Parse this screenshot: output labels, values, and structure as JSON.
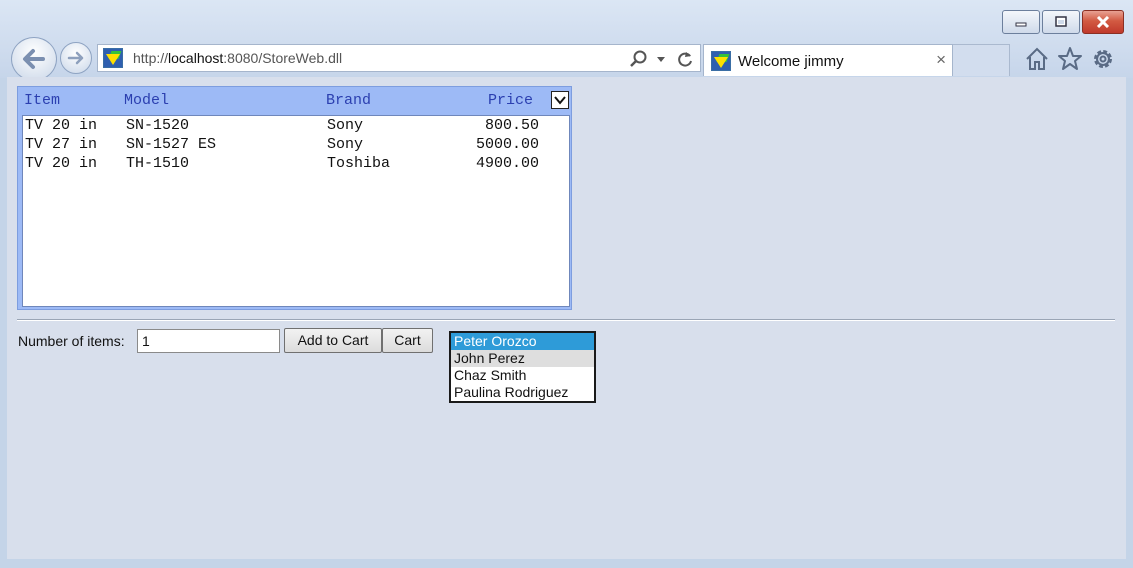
{
  "browser": {
    "url_prefix": "http://",
    "url_host": "localhost",
    "url_rest": ":8080/StoreWeb.dll",
    "tab_title": "Welcome jimmy",
    "tab_close": "×"
  },
  "grid": {
    "headers": {
      "item": "Item",
      "model": "Model",
      "brand": "Brand",
      "price": "Price"
    },
    "rows": [
      {
        "item": "TV 20 in",
        "model": "SN-1520",
        "brand": "Sony",
        "price": "800.50"
      },
      {
        "item": "TV 27 in",
        "model": "SN-1527 ES",
        "brand": "Sony",
        "price": "5000.00"
      },
      {
        "item": "TV 20 in",
        "model": "TH-1510",
        "brand": "Toshiba",
        "price": "4900.00"
      }
    ]
  },
  "form": {
    "qty_label": "Number of items:",
    "qty_value": "1",
    "add_label": "Add to Cart",
    "cart_label": "Cart"
  },
  "users": {
    "selected": "Peter Orozco",
    "items": [
      "Peter Orozco",
      "John Perez",
      "Chaz Smith",
      "Paulina Rodriguez"
    ]
  },
  "icons": [
    "back-icon",
    "forward-icon",
    "search-icon",
    "dropdown-arrow-icon",
    "refresh-icon",
    "home-icon",
    "star-icon",
    "gear-icon",
    "minimize-icon",
    "maximize-icon",
    "close-icon"
  ],
  "colors": {
    "grid_header": "#9dbaf6",
    "selection": "#2e9bd8",
    "close_button": "#c0392b"
  }
}
